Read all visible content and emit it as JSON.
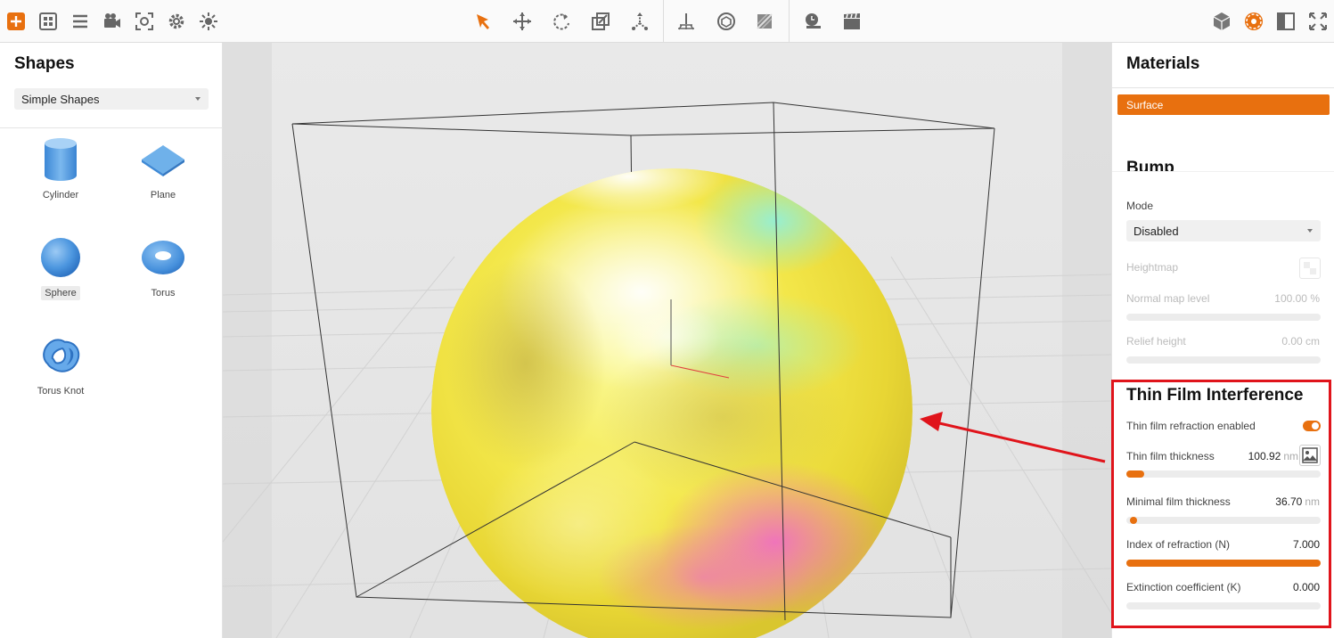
{
  "toolbar": {
    "left_icons": [
      "add-icon",
      "grid-icon",
      "list-icon",
      "camera-icon",
      "focus-icon",
      "settings-icon",
      "light-icon"
    ],
    "center_icons": [
      "select-cursor-icon",
      "move-icon",
      "rotate-icon",
      "scale-icon",
      "transform-icon",
      "ground-icon",
      "render-preview-icon",
      "texture-icon"
    ],
    "right_group_icons": [
      "timer-icon",
      "clapperboard-icon"
    ],
    "panel_icons": [
      "cube-icon",
      "materials-icon",
      "window-icon",
      "expand-icon"
    ],
    "accent": "#e8700f"
  },
  "left_panel": {
    "title": "Shapes",
    "category_select": "Simple Shapes",
    "shapes": [
      {
        "label": "Cylinder",
        "icon": "cylinder-icon"
      },
      {
        "label": "Plane",
        "icon": "plane-icon"
      },
      {
        "label": "Sphere",
        "icon": "sphere-icon",
        "selected": true
      },
      {
        "label": "Torus",
        "icon": "torus-icon"
      },
      {
        "label": "Torus Knot",
        "icon": "torus-knot-icon"
      }
    ]
  },
  "right_panel": {
    "title": "Materials",
    "active_tab": "Surface",
    "partial_heading": "Bump",
    "mode_label": "Mode",
    "mode_value": "Disabled",
    "heightmap_label": "Heightmap",
    "normal_map_label": "Normal map level",
    "normal_map_value": "100.00 %",
    "relief_label": "Relief height",
    "relief_value": "0.00 cm",
    "thin_film": {
      "title": "Thin Film Interference",
      "refraction_label": "Thin film refraction enabled",
      "refraction_enabled": true,
      "thickness_label": "Thin film thickness",
      "thickness_value": "100.92",
      "thickness_unit": "nm",
      "thickness_fraction": 0.09,
      "min_thickness_label": "Minimal film thickness",
      "min_thickness_value": "36.70",
      "min_thickness_unit": "nm",
      "min_thickness_fraction": 0.02,
      "ior_label": "Index of refraction (N)",
      "ior_value": "7.000",
      "ior_fraction": 1.0,
      "extinction_label": "Extinction coefficient (K)",
      "extinction_value": "0.000",
      "extinction_fraction": 0.0
    }
  }
}
